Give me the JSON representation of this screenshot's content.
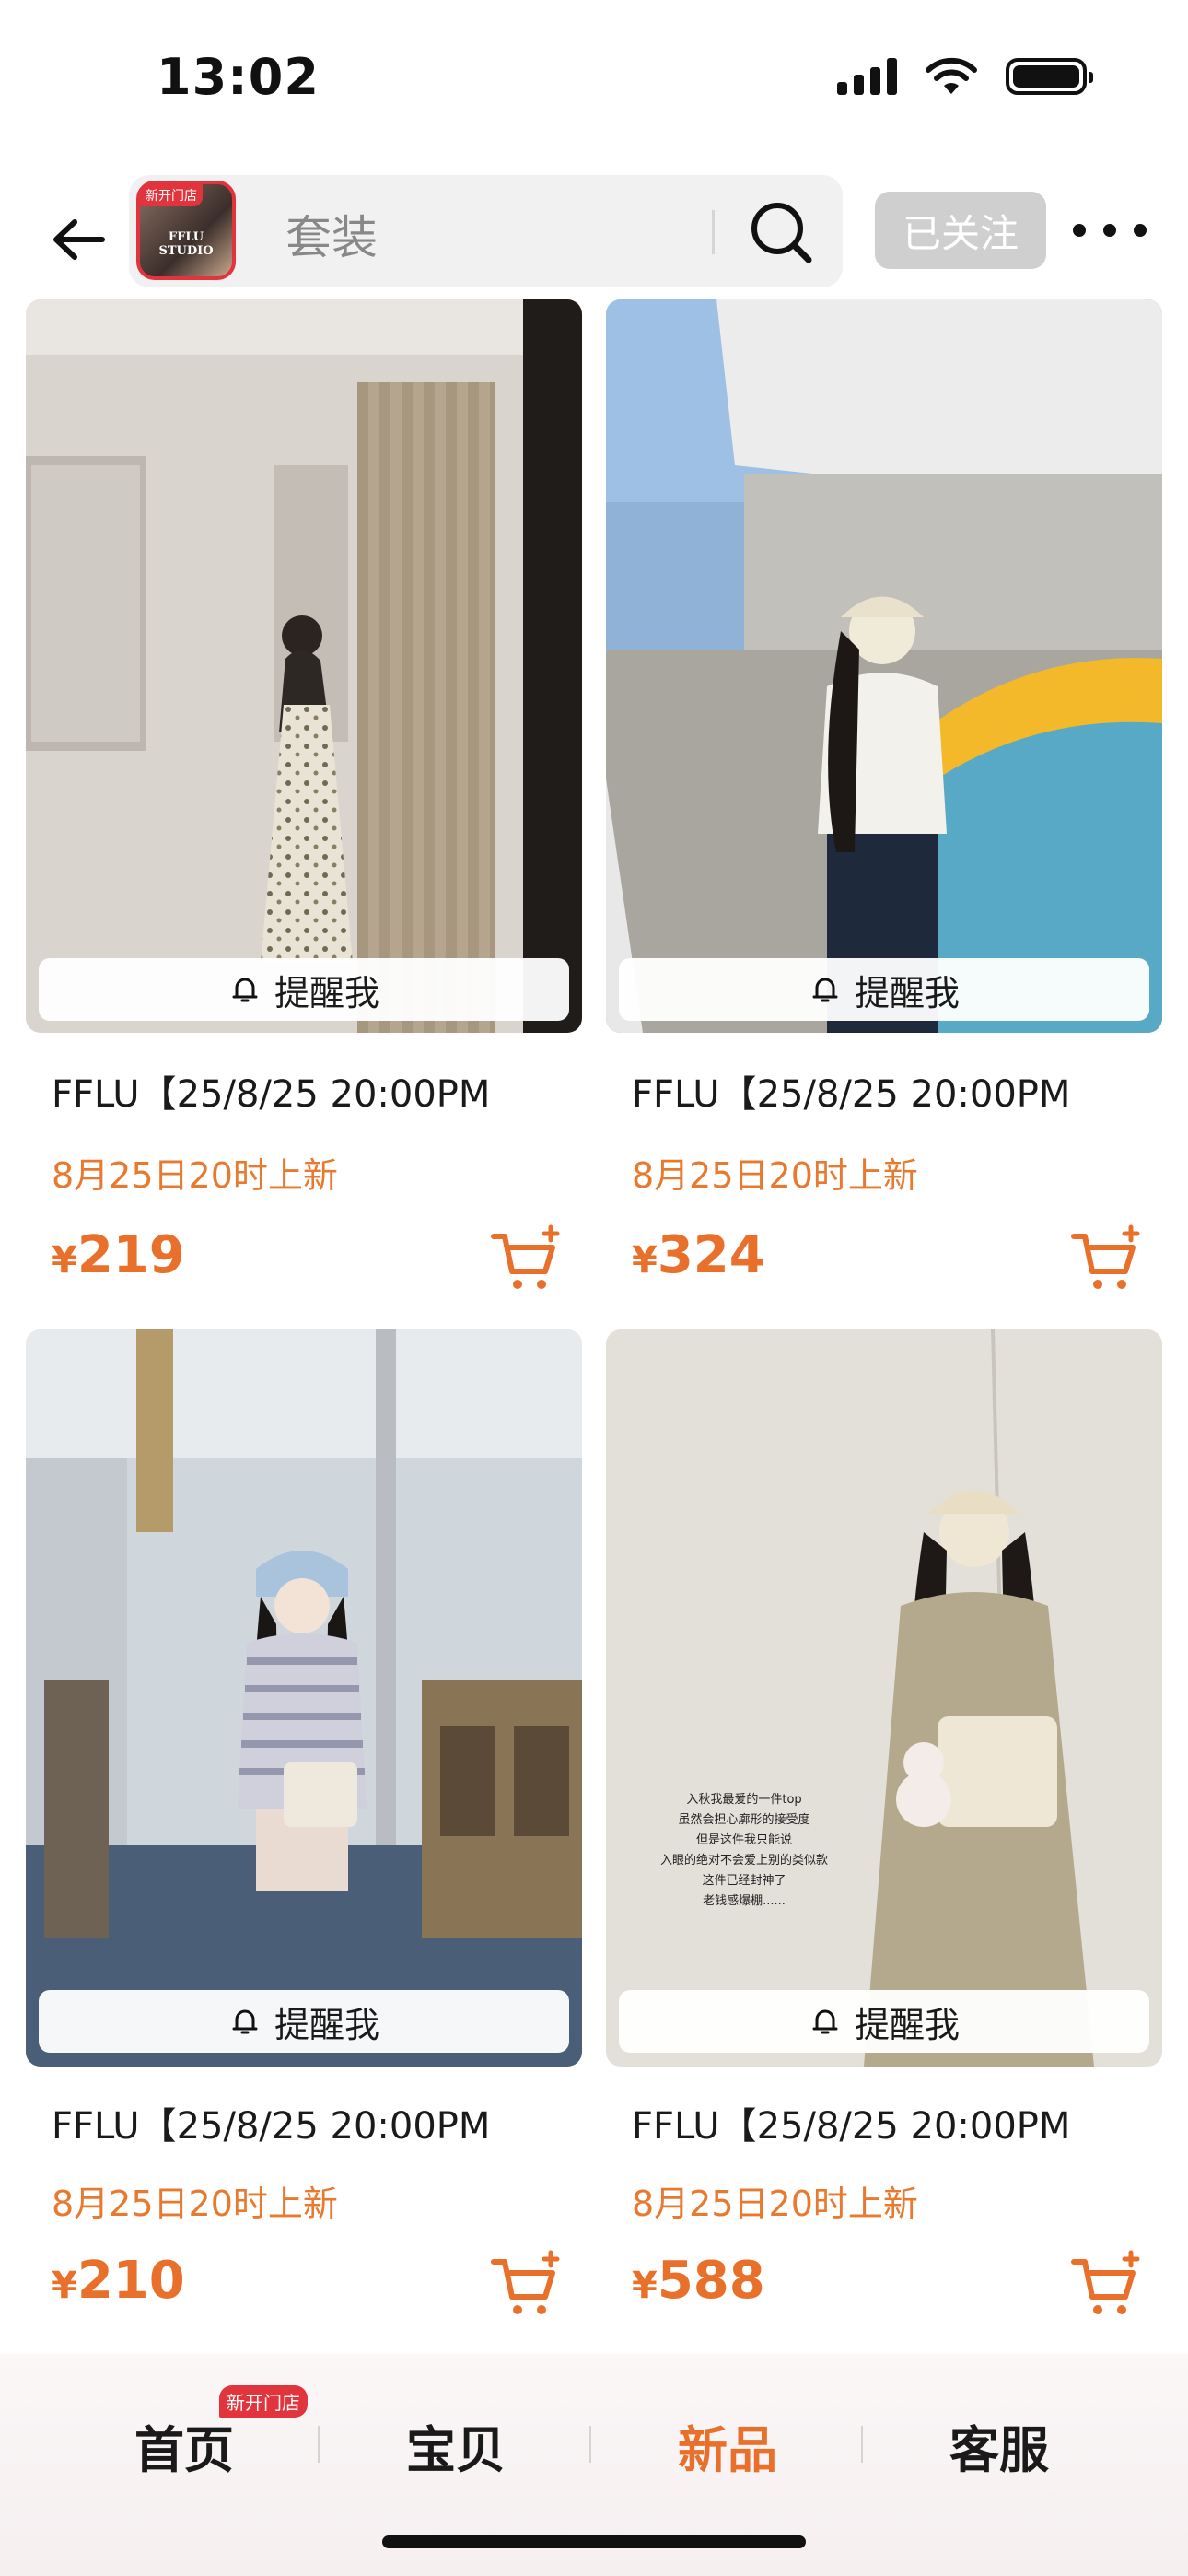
{
  "status_bar": {
    "time": "13:02",
    "icons": [
      "signal-icon",
      "wifi-icon",
      "battery-icon"
    ]
  },
  "header": {
    "back_icon": "back-arrow-icon",
    "shop_logo": {
      "badge": "新开门店",
      "text": "FFLU STUDIO"
    },
    "search_text": "套装",
    "search_icon": "search-icon",
    "follow_label": "已关注",
    "more_icon": "more-dots-icon"
  },
  "products": [
    {
      "title": "FFLU【25/8/25 20:00PM",
      "subtitle": "8月25日20时上新",
      "currency": "¥",
      "price": "219",
      "remind_label": "提醒我"
    },
    {
      "title": "FFLU【25/8/25 20:00PM",
      "subtitle": "8月25日20时上新",
      "currency": "¥",
      "price": "324",
      "remind_label": "提醒我"
    },
    {
      "title": "FFLU【25/8/25 20:00PM",
      "subtitle": "8月25日20时上新",
      "currency": "¥",
      "price": "210",
      "remind_label": "提醒我"
    },
    {
      "title": "FFLU【25/8/25 20:00PM",
      "subtitle": "8月25日20时上新",
      "currency": "¥",
      "price": "588",
      "remind_label": "提醒我"
    }
  ],
  "photo_overlay_text": [
    "入秋我最爱的一件top",
    "虽然会担心廓形的接受度",
    "但是这件我只能说",
    "入眼的绝对不会爱上别的类似款",
    "这件已经封神了",
    "老钱感爆棚......"
  ],
  "tabbar": {
    "tabs": [
      {
        "label": "首页",
        "active": false
      },
      {
        "label": "宝贝",
        "active": false
      },
      {
        "label": "新品",
        "active": true
      },
      {
        "label": "客服",
        "active": false
      }
    ],
    "home_badge": "新开门店"
  },
  "colors": {
    "accent": "#e8702a",
    "subtitle": "#e77a2e",
    "badge": "#e2343c",
    "follow_bg": "#cfcfcf"
  }
}
